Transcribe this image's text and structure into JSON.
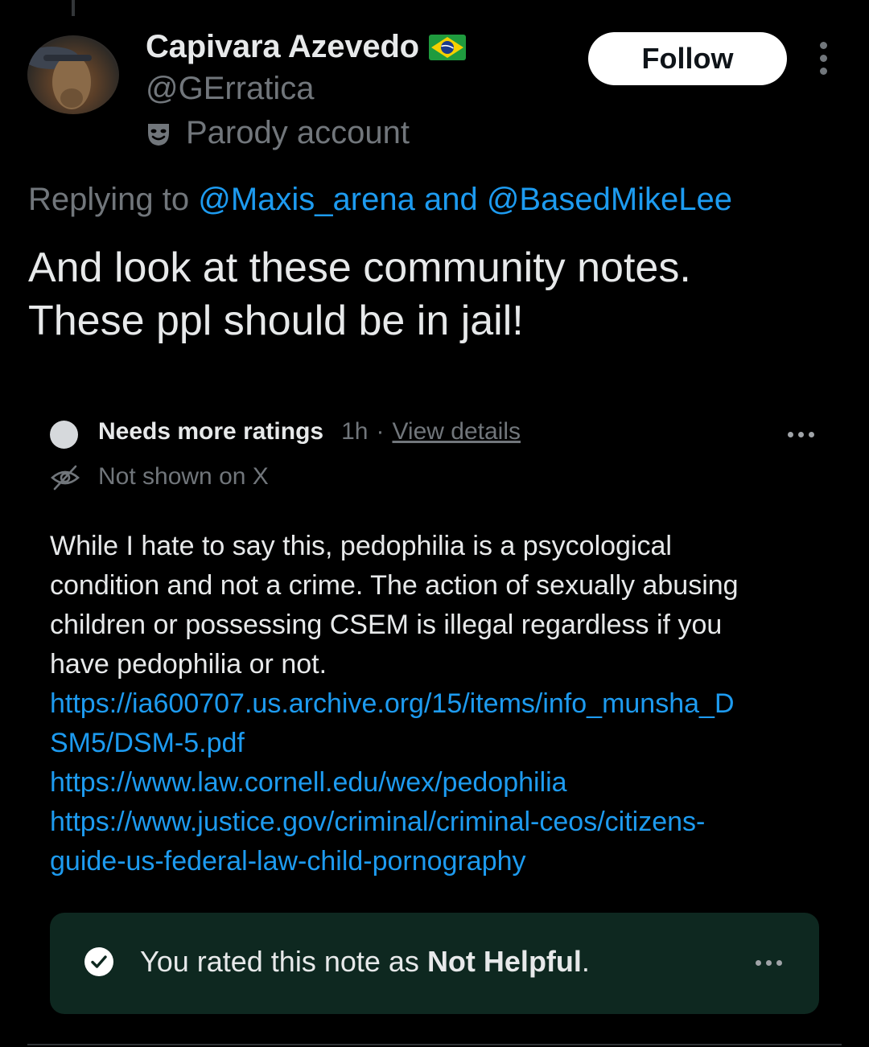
{
  "author": {
    "display_name": "Capivara Azevedo",
    "flag_icon": "brazil-flag-icon",
    "handle": "@GErratica",
    "label_icon": "parody-mask-icon",
    "label": "Parody account"
  },
  "follow_button": {
    "label": "Follow"
  },
  "reply_context": {
    "prefix": "Replying to ",
    "mention_1": "@Maxis_arena",
    "conjunction": " and ",
    "mention_2": "@BasedMikeLee"
  },
  "tweet": {
    "lines": [
      "And look at these community notes.",
      "These ppl should be in jail!"
    ]
  },
  "community_note": {
    "status": "Needs more ratings",
    "time": "1h",
    "separator": "·",
    "details_link": "View details",
    "visibility": "Not shown on X",
    "body_lines": [
      "While I hate to say this, pedophilia is a psycological",
      "condition and not a crime. The action of sexually abusing",
      "children or possessing CSEM is illegal regardless if you",
      "have pedophilia or not."
    ],
    "link_lines": [
      "https://ia600707.us.archive.org/15/items/info_munsha_D",
      "SM5/DSM-5.pdf",
      "https://www.law.cornell.edu/wex/pedophilia",
      "https://www.justice.gov/criminal/criminal-ceos/citizens-",
      "guide-us-federal-law-child-pornography"
    ]
  },
  "rating": {
    "prefix": "You rated this note as ",
    "value": "Not Helpful",
    "suffix": "."
  },
  "colors": {
    "background": "#000000",
    "text_primary": "#e7e9ea",
    "text_secondary": "#71767b",
    "link": "#1d9bf0",
    "rating_box": "#0e2820"
  }
}
